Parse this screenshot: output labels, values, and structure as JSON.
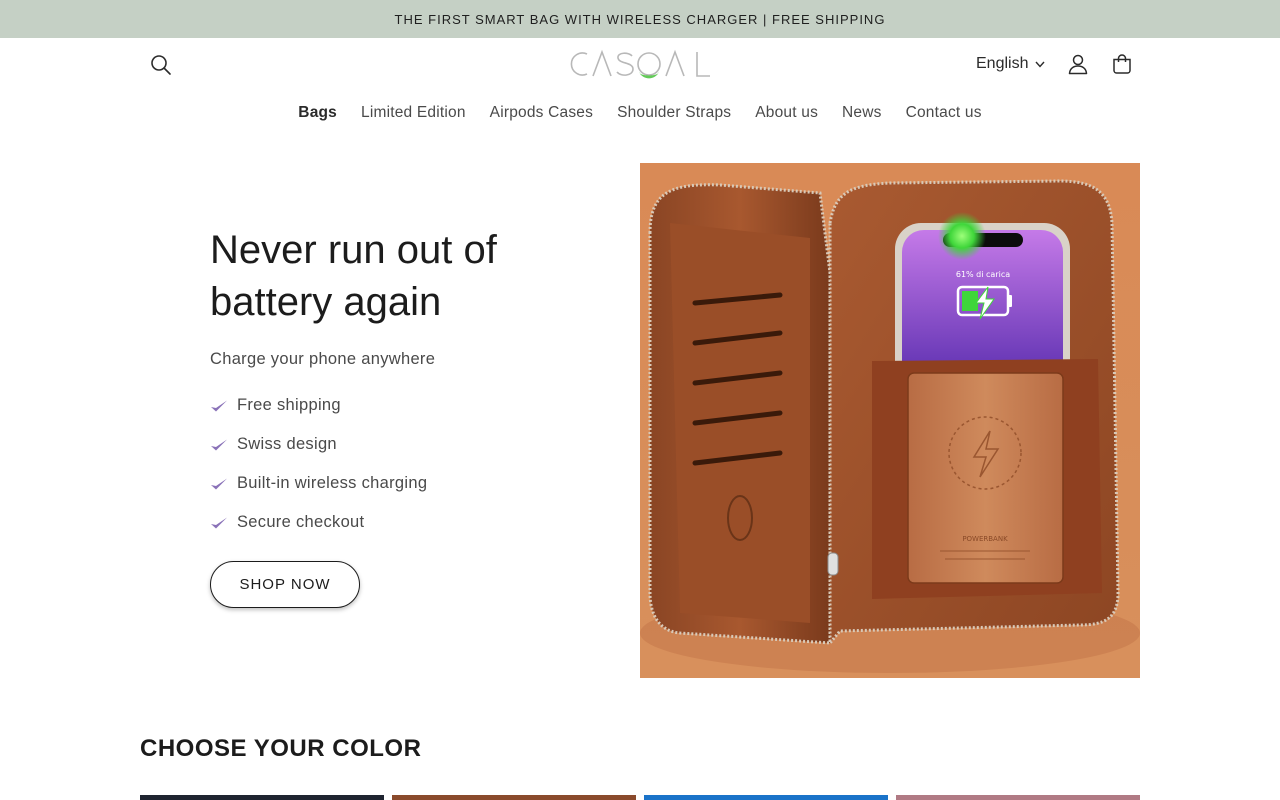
{
  "announcement": "THE FIRST SMART BAG WITH WIRELESS CHARGER | FREE SHIPPING",
  "header": {
    "logo_text": "CASOAL",
    "language": "English",
    "icons": [
      "search-icon",
      "user-icon",
      "shopping-bag-icon",
      "chevron-down-icon"
    ]
  },
  "nav": {
    "items": [
      {
        "label": "Bags",
        "active": true
      },
      {
        "label": "Limited Edition"
      },
      {
        "label": "Airpods Cases"
      },
      {
        "label": "Shoulder Straps"
      },
      {
        "label": "About us"
      },
      {
        "label": "News"
      },
      {
        "label": "Contact us"
      }
    ]
  },
  "hero": {
    "title": "Never run out of battery again",
    "subtitle": "Charge your phone anywhere",
    "features": [
      "Free shipping",
      "Swiss design",
      "Built-in wireless charging",
      "Secure checkout"
    ],
    "cta": "SHOP NOW",
    "image": {
      "phone_text": "61% di carica",
      "tag_text": "POWERBANK"
    }
  },
  "color_section": {
    "title": "CHOOSE YOUR COLOR",
    "swatches": [
      "#1f2430",
      "#8a4a2c",
      "#1a73c9",
      "#b07a84"
    ]
  },
  "colors": {
    "announcement_bg": "#c5d0c5",
    "check": "#8a72b8",
    "leather": "#c87a4f",
    "background_orange": "#d98a56"
  }
}
